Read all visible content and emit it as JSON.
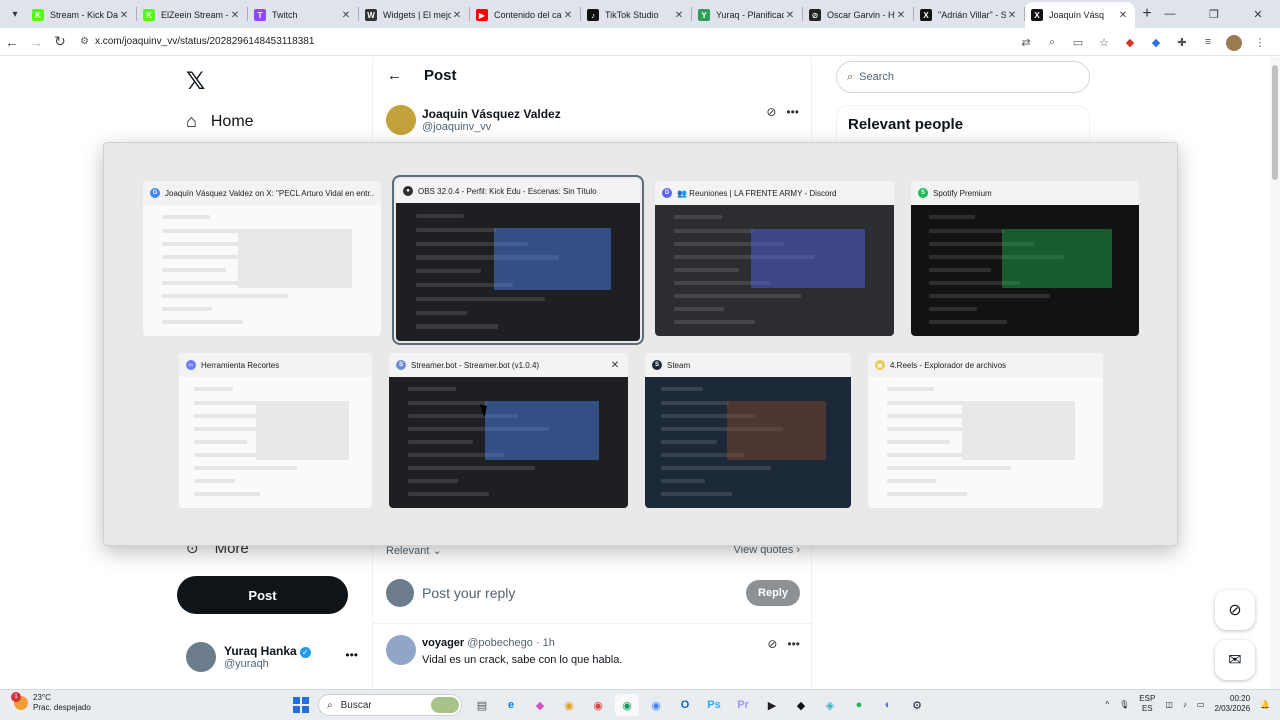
{
  "browser": {
    "tabs": [
      {
        "label": "Stream - Kick Das",
        "color": "#53fc18",
        "glyph": "K",
        "active": false
      },
      {
        "label": "ElZeein Stream - ",
        "color": "#53fc18",
        "glyph": "K",
        "active": false
      },
      {
        "label": "Twitch",
        "color": "#9146ff",
        "glyph": "T",
        "active": false
      },
      {
        "label": "Widgets | El mejo",
        "color": "#333333",
        "glyph": "W",
        "active": false
      },
      {
        "label": "Contenido del ca",
        "color": "#ff0000",
        "glyph": "▶",
        "active": false
      },
      {
        "label": "TikTok Studio",
        "color": "#111111",
        "glyph": "♪",
        "active": false
      },
      {
        "label": "Yuraq - Planificad",
        "color": "#2e9e59",
        "glyph": "Y",
        "active": false
      },
      {
        "label": "Oscar Garvin - Hy",
        "color": "#222222",
        "glyph": "⊘",
        "active": false
      },
      {
        "label": "\"Adrián Villar\" - S",
        "color": "#111111",
        "glyph": "X",
        "active": false
      },
      {
        "label": "Joaquín Vásq",
        "color": "#111111",
        "glyph": "X",
        "active": true
      }
    ],
    "url": "x.com/joaquinv_vv/status/2028296148453118381"
  },
  "x": {
    "logo": "𝕏",
    "nav_home": "Home",
    "nav_more": "More",
    "post_button": "Post",
    "profile": {
      "name": "Yuraq Hanka",
      "handle": "@yuraqh"
    },
    "post_header": "Post",
    "author": {
      "name": "Joaquin Vásquez Valdez",
      "handle": "@joaquinv_vv"
    },
    "relevant_label": "Relevant",
    "view_quotes": "View quotes",
    "reply_placeholder": "Post your reply",
    "reply_button": "Reply",
    "reply": {
      "name": "voyager",
      "handle": "@pobechego",
      "time": "· 1h",
      "text": "Vidal es un crack, sabe con lo que habla."
    },
    "search_placeholder": "Search",
    "relevant_people": "Relevant people"
  },
  "switcher": {
    "windows": [
      {
        "title": "Joaquín Vásquez Valdez on X: \"PECL Arturo Vidal en entr...",
        "icon_color": "#4285f4",
        "glyph": "G",
        "thumb": "light",
        "selected": false
      },
      {
        "title": "OBS 32.0.4 - Perfil: Kick Edu - Escenas: Sin Título",
        "icon_color": "#302e31",
        "glyph": "●",
        "thumb": "dark",
        "selected": true
      },
      {
        "title": "👥 Reuniones | LA FRENTE ARMY - Discord",
        "icon_color": "#5865f2",
        "glyph": "D",
        "thumb": "discord",
        "selected": false
      },
      {
        "title": "Spotify Premium",
        "icon_color": "#1db954",
        "glyph": "S",
        "thumb": "spotify",
        "selected": false
      },
      {
        "title": "Herramienta Recortes",
        "icon_color": "#6b7cff",
        "glyph": "✂",
        "thumb": "light",
        "selected": false
      },
      {
        "title": "Streamer.bot - Streamer.bot (v1.0.4)",
        "icon_color": "#6c8cd5",
        "glyph": "S",
        "thumb": "dark",
        "selected": false,
        "close": "✕"
      },
      {
        "title": "Steam",
        "icon_color": "#1b2838",
        "glyph": "S",
        "thumb": "steam",
        "selected": false
      },
      {
        "title": "4.Reels - Explorador de archivos",
        "icon_color": "#f2c94c",
        "glyph": "▣",
        "thumb": "light",
        "selected": false
      }
    ]
  },
  "taskbar": {
    "weather_temp": "23°C",
    "weather_desc": "Prac. despejado",
    "weather_badge": "1",
    "search_label": "Buscar",
    "apps": [
      {
        "glyph": "▤",
        "color": "#555555"
      },
      {
        "glyph": "e",
        "color": "#0c7bd6"
      },
      {
        "glyph": "◆",
        "color": "#d94fc4"
      },
      {
        "glyph": "◉",
        "color": "#e3a21a"
      },
      {
        "glyph": "◉",
        "color": "#db4437"
      },
      {
        "glyph": "◉",
        "color": "#0f9d58"
      },
      {
        "glyph": "◉",
        "color": "#4285f4"
      },
      {
        "glyph": "O",
        "color": "#0a64c2"
      },
      {
        "glyph": "Ps",
        "color": "#31a8ff"
      },
      {
        "glyph": "Pr",
        "color": "#9999ff"
      },
      {
        "glyph": "▶",
        "color": "#222222"
      },
      {
        "glyph": "◆",
        "color": "#111111"
      },
      {
        "glyph": "◈",
        "color": "#2fb2c4"
      },
      {
        "glyph": "●",
        "color": "#1db954"
      },
      {
        "glyph": "◐",
        "color": "#5865f2"
      },
      {
        "glyph": "⚙",
        "color": "#1b2838"
      }
    ],
    "lang": "ESP",
    "lang_sub": "ES",
    "time": "00:20",
    "date": "2/03/2026"
  }
}
